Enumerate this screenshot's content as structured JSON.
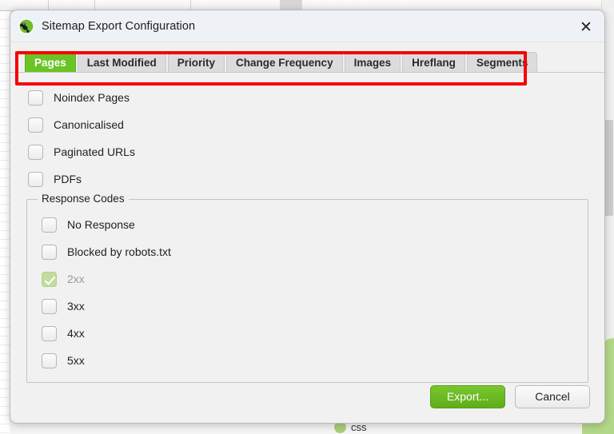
{
  "window": {
    "title": "Sitemap Export Configuration",
    "app_icon": "screaming-frog-icon",
    "close_icon": "✕"
  },
  "annotation": {
    "shape": "rectangle",
    "color": "#f60000",
    "target": "tab-bar"
  },
  "tabs": [
    {
      "label": "Pages",
      "active": true
    },
    {
      "label": "Last Modified",
      "active": false
    },
    {
      "label": "Priority",
      "active": false
    },
    {
      "label": "Change Frequency",
      "active": false
    },
    {
      "label": "Images",
      "active": false
    },
    {
      "label": "Hreflang",
      "active": false
    },
    {
      "label": "Segments",
      "active": false
    }
  ],
  "pages_tab": {
    "options": [
      {
        "label": "Noindex Pages",
        "checked": false,
        "disabled": false
      },
      {
        "label": "Canonicalised",
        "checked": false,
        "disabled": false
      },
      {
        "label": "Paginated URLs",
        "checked": false,
        "disabled": false
      },
      {
        "label": "PDFs",
        "checked": false,
        "disabled": false
      }
    ],
    "response_codes": {
      "title": "Response Codes",
      "options": [
        {
          "label": "No Response",
          "checked": false,
          "disabled": false
        },
        {
          "label": "Blocked by robots.txt",
          "checked": false,
          "disabled": false
        },
        {
          "label": "2xx",
          "checked": true,
          "disabled": true
        },
        {
          "label": "3xx",
          "checked": false,
          "disabled": false
        },
        {
          "label": "4xx",
          "checked": false,
          "disabled": false
        },
        {
          "label": "5xx",
          "checked": false,
          "disabled": false
        }
      ]
    }
  },
  "footer": {
    "export_label": "Export...",
    "cancel_label": "Cancel"
  },
  "background": {
    "bottom_item_label": "css"
  },
  "colors": {
    "accent_green": "#6ac425",
    "annotation_red": "#f60000",
    "checked_green": "#c3dc9d",
    "title_bar": "#eef1f5",
    "dialog_body": "#f1f1f1"
  }
}
